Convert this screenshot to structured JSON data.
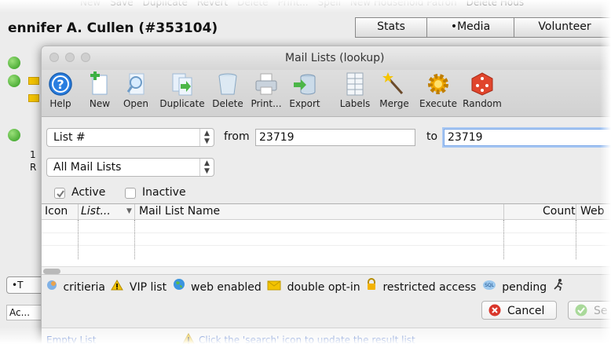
{
  "background": {
    "menu_items": [
      "New",
      "Save",
      "Duplicate",
      "Revert",
      "Delete",
      "Print...",
      "Spell",
      "New Household Patron",
      "Delete Hous"
    ],
    "patron_name": "ennifer A. Cullen (#353104)",
    "tabs": [
      "Stats",
      "•Media",
      "Volunteer"
    ],
    "side_digits": [
      "1",
      "R"
    ],
    "bottom_button": "•T",
    "bottom_field": "Ac..."
  },
  "window": {
    "title": "Mail Lists (lookup)"
  },
  "toolbar": {
    "buttons": [
      {
        "label": "Help",
        "icon": "help-icon"
      },
      {
        "label": "New",
        "icon": "new-document-icon"
      },
      {
        "label": "Open",
        "icon": "open-search-icon"
      },
      {
        "label": "Duplicate",
        "icon": "duplicate-icon"
      },
      {
        "label": "Delete",
        "icon": "trash-icon"
      },
      {
        "label": "Print...",
        "icon": "printer-icon"
      },
      {
        "label": "Export",
        "icon": "export-database-icon"
      },
      {
        "label": "Labels",
        "icon": "labels-icon"
      },
      {
        "label": "Merge",
        "icon": "magic-wand-icon"
      },
      {
        "label": "Execute",
        "icon": "gear-execute-icon"
      },
      {
        "label": "Random",
        "icon": "dice-icon"
      }
    ]
  },
  "search": {
    "field_select": "List #",
    "from_label": "from",
    "from_value": "23719",
    "to_label": "to",
    "to_value": "23719",
    "type_select": "All Mail Lists",
    "active_label": "Active",
    "active_checked": true,
    "inactive_label": "Inactive",
    "inactive_checked": false
  },
  "table": {
    "columns": [
      "Icon",
      "List...",
      "Mail List Name",
      "Count",
      "Web"
    ],
    "rows": []
  },
  "legend": {
    "items": [
      {
        "icon": "criteria-icon",
        "label": "critieria"
      },
      {
        "icon": "warning-icon",
        "label": "VIP list"
      },
      {
        "icon": "globe-icon",
        "label": "web enabled"
      },
      {
        "icon": "envelope-icon",
        "label": "double opt-in"
      },
      {
        "icon": "lock-icon",
        "label": "restricted access"
      },
      {
        "icon": "sql-icon",
        "label": "pending"
      }
    ]
  },
  "buttons": {
    "cancel": "Cancel",
    "select": "Se"
  },
  "status": {
    "left": "Empty List",
    "message": "Click the 'search' icon to update the result list"
  },
  "colors": {
    "link_blue": "#1f4fb8",
    "help_blue": "#2a7ee0",
    "cancel_red": "#d9362b",
    "ok_green": "#5bb43a",
    "warning_yellow": "#f3c300"
  }
}
